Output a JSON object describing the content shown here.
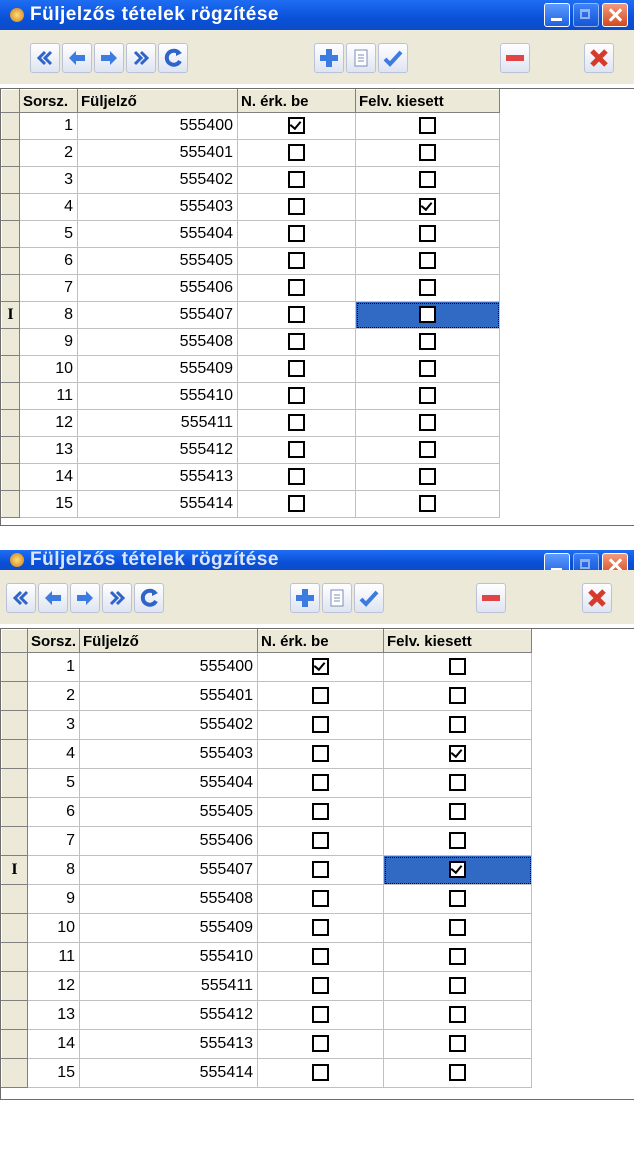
{
  "panels": [
    {
      "title": "Füljelzős tételek rögzítése",
      "columns": [
        "Sorsz.",
        "Füljelző",
        "N. érk. be",
        "Felv. kiesett"
      ],
      "current_row_marker": "I",
      "rows": [
        {
          "no": "1",
          "tag": "555400",
          "n_erk_be": true,
          "felv_kiesett": false
        },
        {
          "no": "2",
          "tag": "555401",
          "n_erk_be": false,
          "felv_kiesett": false
        },
        {
          "no": "3",
          "tag": "555402",
          "n_erk_be": false,
          "felv_kiesett": false
        },
        {
          "no": "4",
          "tag": "555403",
          "n_erk_be": false,
          "felv_kiesett": true
        },
        {
          "no": "5",
          "tag": "555404",
          "n_erk_be": false,
          "felv_kiesett": false
        },
        {
          "no": "6",
          "tag": "555405",
          "n_erk_be": false,
          "felv_kiesett": false
        },
        {
          "no": "7",
          "tag": "555406",
          "n_erk_be": false,
          "felv_kiesett": false
        },
        {
          "no": "8",
          "tag": "555407",
          "n_erk_be": false,
          "felv_kiesett": false,
          "current": true,
          "selected_col": "felv_kiesett"
        },
        {
          "no": "9",
          "tag": "555408",
          "n_erk_be": false,
          "felv_kiesett": false
        },
        {
          "no": "10",
          "tag": "555409",
          "n_erk_be": false,
          "felv_kiesett": false
        },
        {
          "no": "11",
          "tag": "555410",
          "n_erk_be": false,
          "felv_kiesett": false
        },
        {
          "no": "12",
          "tag": "555411",
          "n_erk_be": false,
          "felv_kiesett": false
        },
        {
          "no": "13",
          "tag": "555412",
          "n_erk_be": false,
          "felv_kiesett": false
        },
        {
          "no": "14",
          "tag": "555413",
          "n_erk_be": false,
          "felv_kiesett": false
        },
        {
          "no": "15",
          "tag": "555414",
          "n_erk_be": false,
          "felv_kiesett": false
        }
      ]
    },
    {
      "title": "Füljelzős tételek rögzítése",
      "columns": [
        "Sorsz.",
        "Füljelző",
        "N. érk. be",
        "Felv. kiesett"
      ],
      "current_row_marker": "I",
      "rows": [
        {
          "no": "1",
          "tag": "555400",
          "n_erk_be": true,
          "felv_kiesett": false
        },
        {
          "no": "2",
          "tag": "555401",
          "n_erk_be": false,
          "felv_kiesett": false
        },
        {
          "no": "3",
          "tag": "555402",
          "n_erk_be": false,
          "felv_kiesett": false
        },
        {
          "no": "4",
          "tag": "555403",
          "n_erk_be": false,
          "felv_kiesett": true
        },
        {
          "no": "5",
          "tag": "555404",
          "n_erk_be": false,
          "felv_kiesett": false
        },
        {
          "no": "6",
          "tag": "555405",
          "n_erk_be": false,
          "felv_kiesett": false
        },
        {
          "no": "7",
          "tag": "555406",
          "n_erk_be": false,
          "felv_kiesett": false
        },
        {
          "no": "8",
          "tag": "555407",
          "n_erk_be": false,
          "felv_kiesett": true,
          "current": true,
          "selected_col": "felv_kiesett"
        },
        {
          "no": "9",
          "tag": "555408",
          "n_erk_be": false,
          "felv_kiesett": false
        },
        {
          "no": "10",
          "tag": "555409",
          "n_erk_be": false,
          "felv_kiesett": false
        },
        {
          "no": "11",
          "tag": "555410",
          "n_erk_be": false,
          "felv_kiesett": false
        },
        {
          "no": "12",
          "tag": "555411",
          "n_erk_be": false,
          "felv_kiesett": false
        },
        {
          "no": "13",
          "tag": "555412",
          "n_erk_be": false,
          "felv_kiesett": false
        },
        {
          "no": "14",
          "tag": "555413",
          "n_erk_be": false,
          "felv_kiesett": false
        },
        {
          "no": "15",
          "tag": "555414",
          "n_erk_be": false,
          "felv_kiesett": false
        }
      ]
    }
  ],
  "toolbar_icons": [
    "first-record-icon",
    "prior-record-icon",
    "next-record-icon",
    "last-record-icon",
    "refresh-icon",
    "insert-icon",
    "edit-icon",
    "post-icon",
    "delete-icon",
    "cancel-icon"
  ],
  "colors": {
    "titlebar": "#0a51d8",
    "selection": "#316ac5",
    "chrome": "#ece9d8"
  }
}
